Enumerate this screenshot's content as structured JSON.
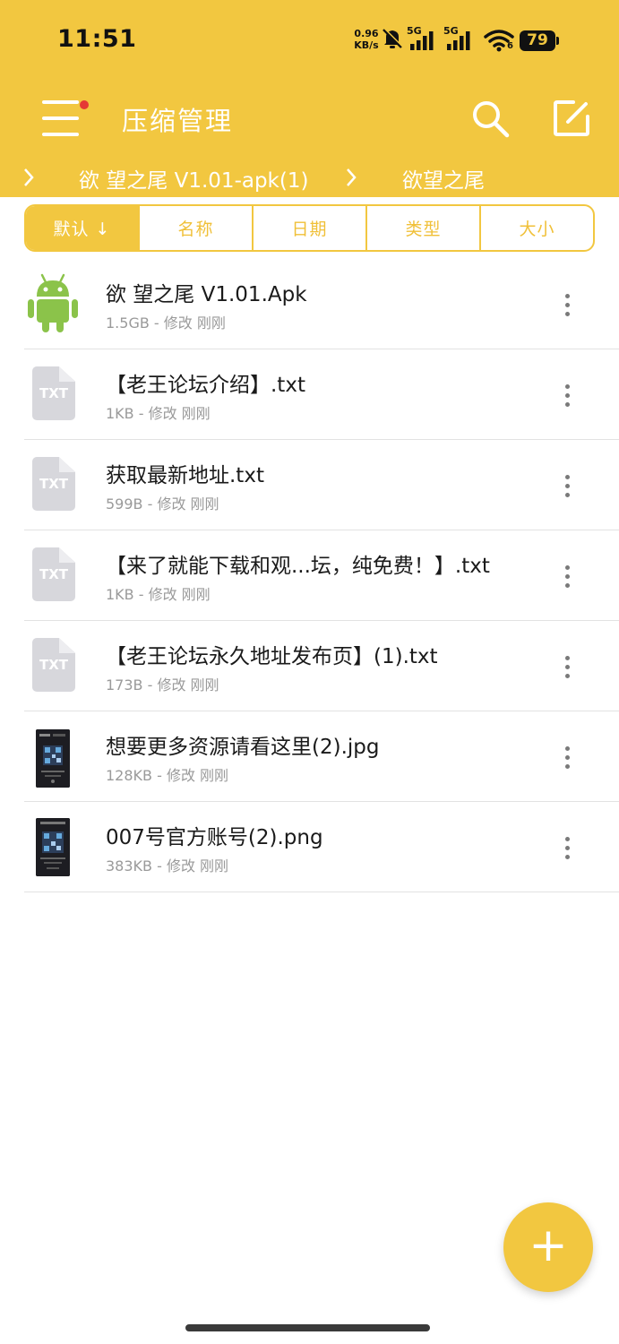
{
  "status_bar": {
    "time": "11:51",
    "net_speed_value": "0.96",
    "net_speed_unit": "KB/s",
    "sim1_label": "5G",
    "sim2_label": "5G",
    "wifi_label": "6",
    "battery": "79",
    "icons": [
      "mute-icon",
      "signal-icon",
      "signal-icon",
      "wifi-icon",
      "battery-icon"
    ]
  },
  "toolbar": {
    "title": "压缩管理",
    "menu_icon": "menu-icon",
    "search_icon": "search-icon",
    "edit_icon": "edit-icon",
    "has_notification_dot": true
  },
  "breadcrumb": [
    {
      "label": "欲 望之尾 V1.01-apk(1)"
    },
    {
      "label": "欲望之尾"
    }
  ],
  "sort_tabs": [
    {
      "label": "默认 ↓",
      "active": true
    },
    {
      "label": "名称",
      "active": false
    },
    {
      "label": "日期",
      "active": false
    },
    {
      "label": "类型",
      "active": false
    },
    {
      "label": "大小",
      "active": false
    }
  ],
  "files": [
    {
      "name": "欲 望之尾 V1.01.Apk",
      "meta": "1.5GB - 修改 刚刚",
      "icon": "android-icon"
    },
    {
      "name": "【老王论坛介绍】.txt",
      "meta": "1KB - 修改 刚刚",
      "icon": "txt-file-icon"
    },
    {
      "name": "获取最新地址.txt",
      "meta": "599B - 修改 刚刚",
      "icon": "txt-file-icon"
    },
    {
      "name": "【来了就能下载和观...坛，纯免费！】.txt",
      "meta": "1KB - 修改 刚刚",
      "icon": "txt-file-icon"
    },
    {
      "name": "【老王论坛永久地址发布页】(1).txt",
      "meta": "173B - 修改 刚刚",
      "icon": "txt-file-icon"
    },
    {
      "name": "想要更多资源请看这里(2).jpg",
      "meta": "128KB - 修改 刚刚",
      "icon": "image-thumbnail"
    },
    {
      "name": "007号官方账号(2).png",
      "meta": "383KB - 修改 刚刚",
      "icon": "image-thumbnail"
    }
  ],
  "txt_icon_label": "TXT",
  "fab_label": "+",
  "colors": {
    "accent": "#F2C740",
    "android_green": "#8BC34A",
    "notification_dot": "#E53935",
    "meta_text": "#9a9a9a"
  }
}
